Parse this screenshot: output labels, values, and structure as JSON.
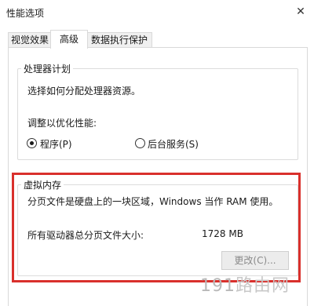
{
  "window": {
    "title": "性能选项",
    "close_glyph": "✕"
  },
  "tabs": [
    {
      "label": "视觉效果",
      "active": false
    },
    {
      "label": "高级",
      "active": true
    },
    {
      "label": "数据执行保护",
      "active": false
    }
  ],
  "processor": {
    "legend": "处理器计划",
    "description": "选择如何分配处理器资源。",
    "adjust_label": "调整以优化性能:",
    "options": [
      {
        "label": "程序(P)",
        "selected": true
      },
      {
        "label": "后台服务(S)",
        "selected": false
      }
    ]
  },
  "virtual_memory": {
    "legend": "虚拟内存",
    "description": "分页文件是硬盘上的一块区域，Windows 当作 RAM 使用。",
    "total_label": "所有驱动器总分页文件大小:",
    "total_value": "1728 MB",
    "change_button": "更改(C)...",
    "highlight_color": "#d9302c"
  },
  "watermark": {
    "number": "191",
    "text": "路由网"
  }
}
